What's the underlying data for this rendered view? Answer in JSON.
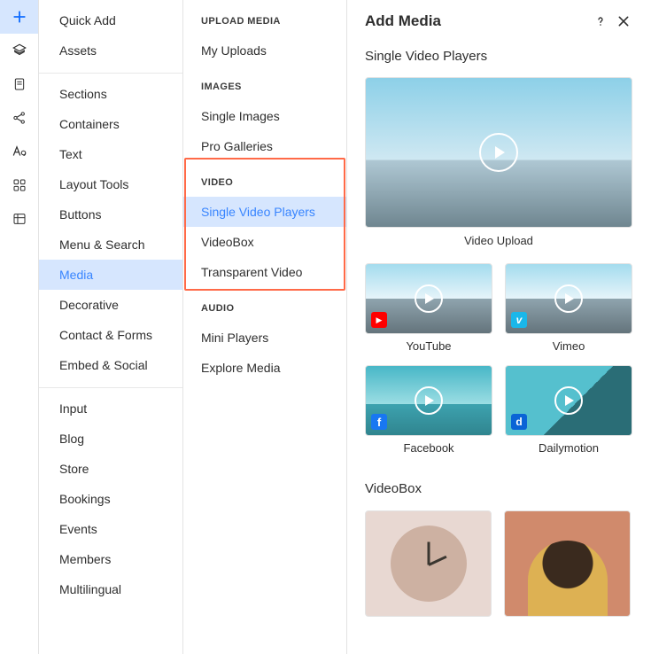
{
  "rail": {
    "items": [
      {
        "name": "plus-icon"
      },
      {
        "name": "layers-icon"
      },
      {
        "name": "page-icon"
      },
      {
        "name": "share-icon"
      },
      {
        "name": "text-icon"
      },
      {
        "name": "apps-icon"
      },
      {
        "name": "table-icon"
      }
    ]
  },
  "col1": {
    "group1": [
      {
        "label": "Quick Add"
      },
      {
        "label": "Assets"
      }
    ],
    "group2": [
      {
        "label": "Sections"
      },
      {
        "label": "Containers"
      },
      {
        "label": "Text"
      },
      {
        "label": "Layout Tools"
      },
      {
        "label": "Buttons"
      },
      {
        "label": "Menu & Search"
      },
      {
        "label": "Media",
        "selected": true
      },
      {
        "label": "Decorative"
      },
      {
        "label": "Contact & Forms"
      },
      {
        "label": "Embed & Social"
      }
    ],
    "group3": [
      {
        "label": "Input"
      },
      {
        "label": "Blog"
      },
      {
        "label": "Store"
      },
      {
        "label": "Bookings"
      },
      {
        "label": "Events"
      },
      {
        "label": "Members"
      },
      {
        "label": "Multilingual"
      }
    ]
  },
  "col2": {
    "upload": {
      "title": "UPLOAD MEDIA",
      "items": [
        {
          "label": "My Uploads"
        }
      ]
    },
    "images": {
      "title": "IMAGES",
      "items": [
        {
          "label": "Single Images"
        },
        {
          "label": "Pro Galleries"
        }
      ]
    },
    "video": {
      "title": "VIDEO",
      "items": [
        {
          "label": "Single Video Players",
          "selected": true
        },
        {
          "label": "VideoBox"
        },
        {
          "label": "Transparent Video"
        }
      ]
    },
    "audio": {
      "title": "AUDIO",
      "items": [
        {
          "label": "Mini Players"
        },
        {
          "label": "Explore Media"
        }
      ]
    }
  },
  "panel": {
    "title": "Add Media",
    "section1": {
      "heading": "Single Video Players",
      "hero": {
        "caption": "Video Upload"
      },
      "tiles": [
        {
          "caption": "YouTube",
          "brand_color": "#ff0000",
          "brand_icon": "▶"
        },
        {
          "caption": "Vimeo",
          "brand_color": "#1ab7ea",
          "brand_icon": "v"
        },
        {
          "caption": "Facebook",
          "brand_color": "#1877f2",
          "brand_icon": "f"
        },
        {
          "caption": "Dailymotion",
          "brand_color": "#0a64d6",
          "brand_icon": "d"
        }
      ]
    },
    "section2": {
      "heading": "VideoBox"
    }
  }
}
